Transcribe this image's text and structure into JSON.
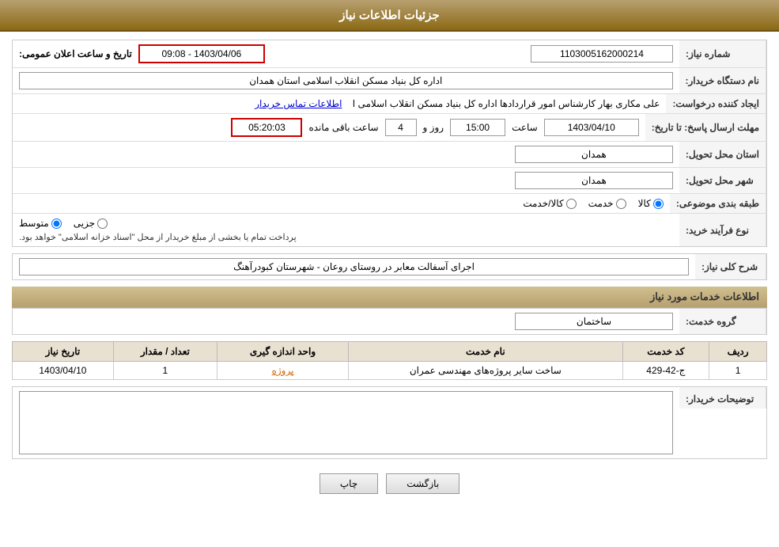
{
  "header": {
    "title": "جزئیات اطلاعات نیاز"
  },
  "labels": {
    "need_number": "شماره نیاز:",
    "buyer_org": "نام دستگاه خریدار:",
    "requester": "ایجاد کننده درخواست:",
    "response_deadline": "مهلت ارسال پاسخ: تا تاریخ:",
    "province": "استان محل تحویل:",
    "city": "شهر محل تحویل:",
    "category": "طبقه بندی موضوعی:",
    "purchase_type": "نوع فرآیند خرید:",
    "description": "شرح کلی نیاز:",
    "services_section": "اطلاعات خدمات مورد نیاز",
    "service_group": "گروه خدمت:",
    "buyer_notes": "توضیحات خریدار:"
  },
  "values": {
    "need_number": "1103005162000214",
    "announce_date_label": "تاریخ و ساعت اعلان عمومی:",
    "announce_date_value": "1403/04/06 - 09:08",
    "buyer_org": "اداره کل بنیاد مسکن انقلاب اسلامی استان همدان",
    "requester_name": "علی مکاری بهار کارشناس امور قراردادها اداره کل بنیاد مسکن انقلاب اسلامی ا",
    "contact_link": "اطلاعات تماس خریدار",
    "deadline_date": "1403/04/10",
    "deadline_time_label": "ساعت",
    "deadline_time": "15:00",
    "deadline_days_label": "روز و",
    "deadline_days": "4",
    "remaining_label": "ساعت باقی مانده",
    "remaining_time": "05:20:03",
    "province_value": "همدان",
    "city_value": "همدان",
    "category_options": [
      "کالا",
      "خدمت",
      "کالا/خدمت"
    ],
    "category_selected": "کالا",
    "purchase_options": [
      "جزیی",
      "متوسط"
    ],
    "purchase_note": "پرداخت تمام یا بخشی از مبلغ خریدار از محل \"اسناد خزانه اسلامی\" خواهد بود.",
    "description_value": "اجرای آسفالت معابر در روستای روعان - شهرستان کبودرآهنگ",
    "service_group_value": "ساختمان",
    "table_headers": [
      "ردیف",
      "کد خدمت",
      "نام خدمت",
      "واحد اندازه گیری",
      "تعداد / مقدار",
      "تاریخ نیاز"
    ],
    "table_rows": [
      {
        "row": "1",
        "code": "ج-42-429",
        "name": "ساخت سایر پروژه‌های مهندسی عمران",
        "unit": "پروژه",
        "quantity": "1",
        "date": "1403/04/10"
      }
    ],
    "buttons": {
      "print": "چاپ",
      "back": "بازگشت"
    }
  }
}
